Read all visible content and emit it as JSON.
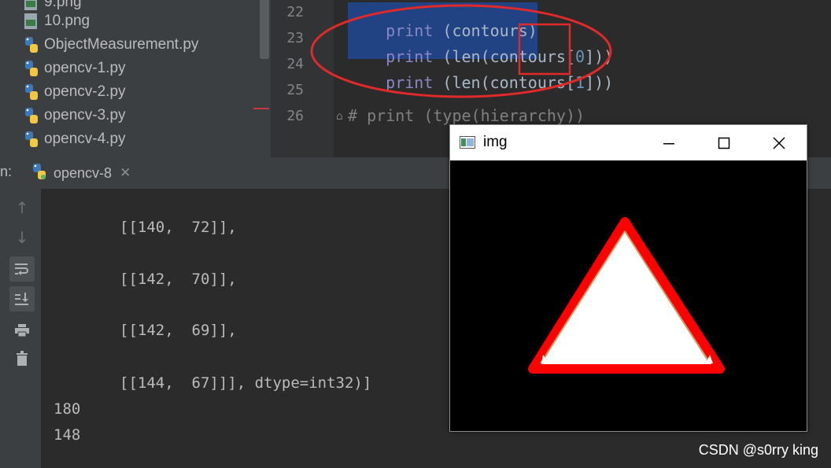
{
  "project": {
    "files": [
      {
        "name": "9.png",
        "type": "png-icon"
      },
      {
        "name": "10.png",
        "type": "png-icon"
      },
      {
        "name": "ObjectMeasurement.py",
        "type": "python-icon"
      },
      {
        "name": "opencv-1.py",
        "type": "python-icon"
      },
      {
        "name": "opencv-2.py",
        "type": "python-icon"
      },
      {
        "name": "opencv-3.py",
        "type": "python-icon"
      },
      {
        "name": "opencv-4.py",
        "type": "python-icon"
      }
    ]
  },
  "editor": {
    "lines": [
      {
        "no": "22",
        "p1": "print",
        "p2": " (contours)"
      },
      {
        "no": "23",
        "p1": "print",
        "p2": " (len(contours[",
        "idx": "0",
        "p3": "]))"
      },
      {
        "no": "24",
        "p1": "print",
        "p2": " (len(contours[",
        "idx": "1",
        "p3": "]))"
      },
      {
        "no": "25",
        "text": ""
      },
      {
        "no": "26",
        "text": "# print (type(hierarchy))"
      }
    ],
    "annotation_color": "#e02a2a"
  },
  "run": {
    "label": "n:",
    "tab_name": "opencv-8",
    "tab_close": "✕",
    "output": [
      "[[140,  72]],",
      "[[142,  70]],",
      "[[142,  69]],",
      "[[144,  67]]], dtype=int32)]",
      "180",
      "148"
    ]
  },
  "img_window": {
    "title": "img",
    "minimize": "—",
    "maximize": "☐",
    "close": "✕",
    "shape_fill": "#ffffff",
    "shape_outline": "#ff0000"
  },
  "watermark": "CSDN @s0rry king"
}
